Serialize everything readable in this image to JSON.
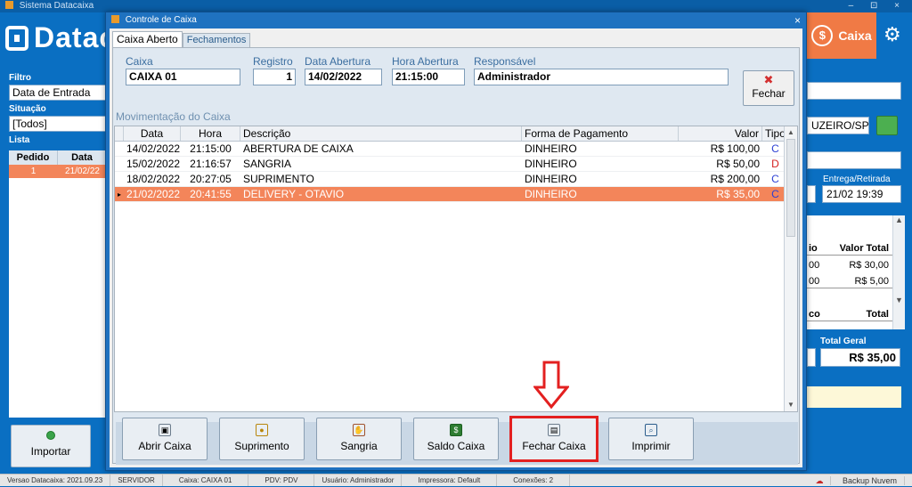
{
  "app": {
    "title": "Sistema Datacaixa",
    "brand": "Datac",
    "caixa_tab": "Caixa",
    "window_controls": "– ⊡ ×"
  },
  "left_panel": {
    "filtro_label": "Filtro",
    "filtro_value": "Data de Entrada",
    "situacao_label": "Situação",
    "situacao_value": "[Todos]",
    "lista_label": "Lista",
    "columns": [
      "Pedido",
      "Data"
    ],
    "row": [
      "1",
      "21/02/22"
    ],
    "import_button": "Importar"
  },
  "right_panel": {
    "city": "UZEIRO/SP",
    "entrega_label": "Entrega/Retirada",
    "entrega_value": "21/02 19:39",
    "list_header": [
      "io",
      "Valor Total"
    ],
    "list_rows": [
      [
        "00",
        "R$ 30,00"
      ],
      [
        "00",
        "R$ 5,00"
      ]
    ],
    "list_footer": [
      "co",
      "Total"
    ],
    "total_geral_label": "Total Geral",
    "total_geral_value": "R$ 35,00"
  },
  "dialog": {
    "title": "Controle de Caixa",
    "close": "×",
    "tabs": [
      "Caixa Aberto",
      "Fechamentos"
    ],
    "fields": {
      "caixa_label": "Caixa",
      "caixa_value": "CAIXA 01",
      "registro_label": "Registro",
      "registro_value": "1",
      "data_label": "Data Abertura",
      "data_value": "14/02/2022",
      "hora_label": "Hora Abertura",
      "hora_value": "21:15:00",
      "resp_label": "Responsável",
      "resp_value": "Administrador"
    },
    "fechar_button": "Fechar",
    "section_title": "Movimentação do Caixa",
    "grid": {
      "columns": [
        "Data",
        "Hora",
        "Descrição",
        "Forma de Pagamento",
        "Valor",
        "Tipo"
      ],
      "rows": [
        {
          "data": "14/02/2022",
          "hora": "21:15:00",
          "descricao": "ABERTURA DE CAIXA",
          "forma": "DINHEIRO",
          "valor": "R$ 100,00",
          "tipo": "C"
        },
        {
          "data": "15/02/2022",
          "hora": "21:16:57",
          "descricao": "SANGRIA",
          "forma": "DINHEIRO",
          "valor": "R$ 50,00",
          "tipo": "D"
        },
        {
          "data": "18/02/2022",
          "hora": "20:27:05",
          "descricao": "SUPRIMENTO",
          "forma": "DINHEIRO",
          "valor": "R$ 200,00",
          "tipo": "C"
        },
        {
          "data": "21/02/2022",
          "hora": "20:41:55",
          "descricao": "DELIVERY - OTAVIO",
          "forma": "DINHEIRO",
          "valor": "R$ 35,00",
          "tipo": "C"
        }
      ]
    },
    "buttons": [
      "Abrir Caixa",
      "Suprimento",
      "Sangria",
      "Saldo Caixa",
      "Fechar Caixa",
      "Imprimir"
    ]
  },
  "statusbar": {
    "versao": "Versao Datacaixa: 2021.09.23",
    "servidor": "SERVIDOR",
    "caixa": "Caixa: CAIXA 01",
    "pdv": "PDV: PDV",
    "usuario": "Usuário: Administrador",
    "impressora": "Impressora: Default",
    "conexoes": "Conexões: 2",
    "backup": "Backup Nuvem"
  },
  "colors": {
    "app_blue": "#0a6fc2",
    "accent_orange": "#f07a45",
    "selected_row": "#f3855a",
    "highlight_red": "#e32020"
  }
}
